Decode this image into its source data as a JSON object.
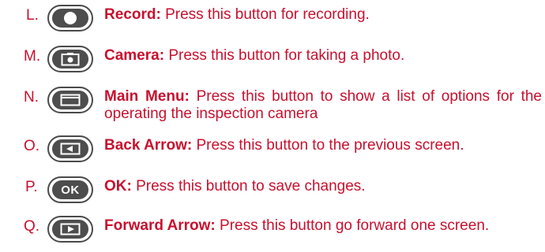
{
  "colors": {
    "text": "#c8102e",
    "button_dark": "#4d4d4d",
    "button_ring": "#4a4a4a",
    "button_face": "#ffffff"
  },
  "items": [
    {
      "letter": "L.",
      "icon": "record-dot-icon",
      "term": "Record:",
      "text": "Press this button for recording."
    },
    {
      "letter": "M.",
      "icon": "camera-icon",
      "term": "Camera:",
      "text": "Press this button for taking a photo."
    },
    {
      "letter": "N.",
      "icon": "menu-icon",
      "term": "Main Menu:",
      "text": "Press this button to show a list of options for the operating the inspection camera"
    },
    {
      "letter": "O.",
      "icon": "back-arrow-icon",
      "term": "Back Arrow:",
      "text": "Press this button to the previous screen."
    },
    {
      "letter": "P.",
      "icon": "ok-label",
      "term": "OK:",
      "text": "Press this button to save changes.",
      "button_label": "OK"
    },
    {
      "letter": "Q.",
      "icon": "forward-arrow-icon",
      "term": "Forward Arrow:",
      "text": "Press this button go forward one screen."
    }
  ]
}
